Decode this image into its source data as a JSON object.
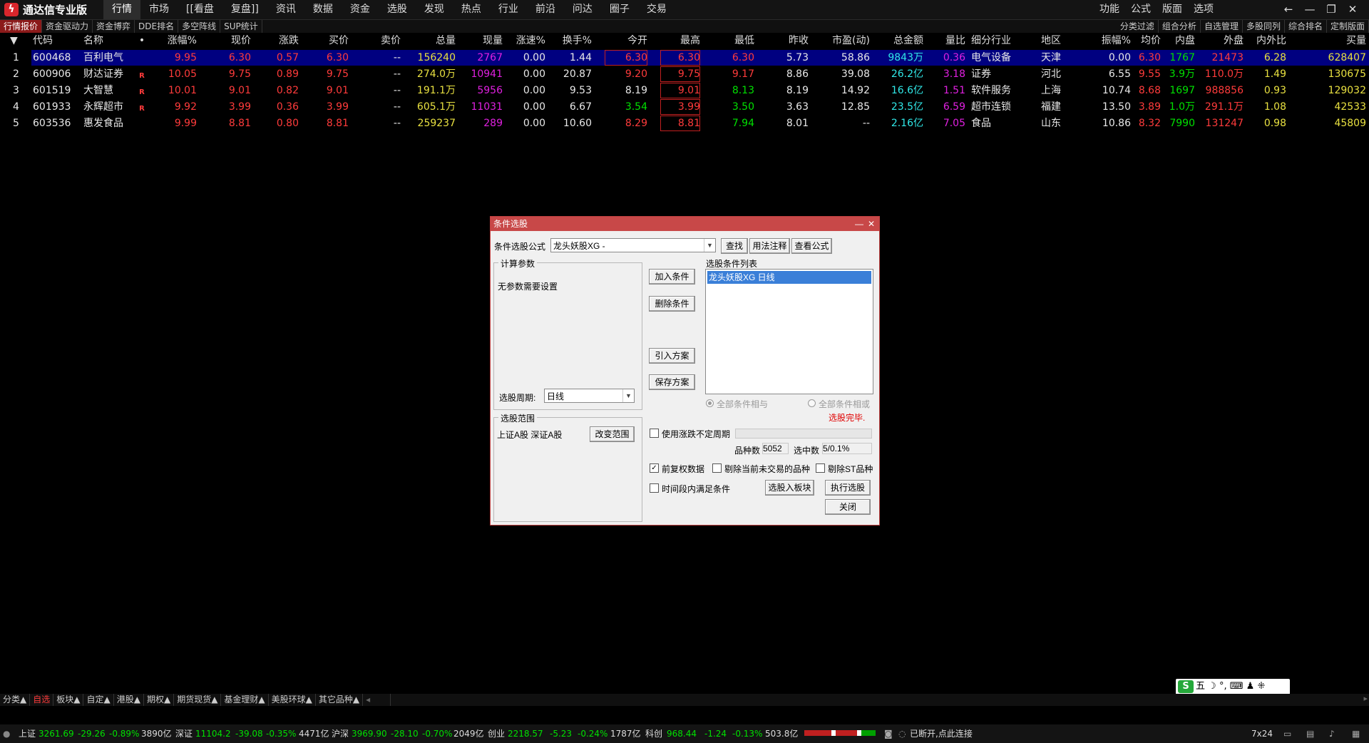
{
  "titlebar": {
    "app_name": "通达信专业版",
    "menu": [
      "行情",
      "市场",
      "[[看盘",
      "复盘]]",
      "资讯",
      "数据",
      "资金",
      "选股",
      "发现",
      "热点",
      "行业",
      "前沿",
      "问达",
      "圈子",
      "交易"
    ],
    "right_menu": [
      "功能",
      "公式",
      "版面",
      "选项"
    ]
  },
  "subtabs": [
    "行情报价",
    "资金驱动力",
    "资金博弈",
    "DDE排名",
    "多空阵线",
    "SUP统计"
  ],
  "subtabs_right": [
    "分类过滤",
    "组合分析",
    "自选管理",
    "多股同列",
    "综合排名",
    "定制版面"
  ],
  "table": {
    "headers": [
      "代码",
      "名称",
      "•",
      "涨幅%",
      "现价",
      "涨跌",
      "买价",
      "卖价",
      "总量",
      "现量",
      "涨速%",
      "换手%",
      "今开",
      "最高",
      "最低",
      "昨收",
      "市盈(动)",
      "总金额",
      "量比",
      "细分行业",
      "地区",
      "振幅%",
      "均价",
      "内盘",
      "外盘",
      "内外比",
      "买量"
    ],
    "rows": [
      [
        "1",
        "600468",
        "百利电气",
        "",
        "9.95",
        "6.30",
        "0.57",
        "6.30",
        "--",
        "156240",
        "2767",
        "0.00",
        "1.44",
        "6.30",
        "6.30",
        "6.30",
        "5.73",
        "58.86",
        "9843万",
        "0.36",
        "电气设备",
        "天津",
        "0.00",
        "6.30",
        "1767",
        "21473",
        "6.28",
        "628407"
      ],
      [
        "2",
        "600906",
        "财达证券",
        "R",
        "10.05",
        "9.75",
        "0.89",
        "9.75",
        "--",
        "274.0万",
        "10941",
        "0.00",
        "20.87",
        "9.20",
        "9.75",
        "9.17",
        "8.86",
        "39.08",
        "26.2亿",
        "3.18",
        "证券",
        "河北",
        "6.55",
        "9.55",
        "3.9万",
        "110.0万",
        "1.49",
        "130675"
      ],
      [
        "3",
        "601519",
        "大智慧",
        "R",
        "10.01",
        "9.01",
        "0.82",
        "9.01",
        "--",
        "191.1万",
        "5956",
        "0.00",
        "9.53",
        "8.19",
        "9.01",
        "8.13",
        "8.19",
        "14.92",
        "16.6亿",
        "1.51",
        "软件服务",
        "上海",
        "10.74",
        "8.68",
        "1697",
        "988856",
        "0.93",
        "129032"
      ],
      [
        "4",
        "601933",
        "永辉超市",
        "R",
        "9.92",
        "3.99",
        "0.36",
        "3.99",
        "--",
        "605.1万",
        "11031",
        "0.00",
        "6.67",
        "3.54",
        "3.99",
        "3.50",
        "3.63",
        "12.85",
        "23.5亿",
        "6.59",
        "超市连锁",
        "福建",
        "13.50",
        "3.89",
        "1.0万",
        "291.1万",
        "1.08",
        "42533"
      ],
      [
        "5",
        "603536",
        "惠发食品",
        "",
        "9.99",
        "8.81",
        "0.80",
        "8.81",
        "--",
        "259237",
        "289",
        "0.00",
        "10.60",
        "8.29",
        "8.81",
        "7.94",
        "8.01",
        "--",
        "2.16亿",
        "7.05",
        "食品",
        "山东",
        "10.86",
        "8.32",
        "7990",
        "131247",
        "0.98",
        "45809"
      ]
    ]
  },
  "dialog": {
    "title": "条件选股",
    "formula_label": "条件选股公式",
    "formula_value": "龙头妖股XG   -",
    "btn_find": "查找",
    "btn_usage": "用法注释",
    "btn_view": "查看公式",
    "calc_params_label": "计算参数",
    "no_params": "无参数需要设置",
    "period_label": "选股周期:",
    "period_value": "日线",
    "btn_add": "加入条件",
    "btn_delete": "删除条件",
    "btn_import": "引入方案",
    "btn_save": "保存方案",
    "cond_list_label": "选股条件列表",
    "cond_item": "龙头妖股XG  日线",
    "radio_and": "全部条件相与",
    "radio_or": "全部条件相或",
    "status": "选股完毕.",
    "range_label": "选股范围",
    "range_value": "上证A股 深证A股",
    "btn_change_range": "改变范围",
    "chk_use_period": "使用涨跌不定周期",
    "count_label": "品种数",
    "count_value": "5052",
    "selected_label": "选中数",
    "selected_value": "5/0.1%",
    "chk_prefq": "前复权数据",
    "chk_remove_notrade": "剔除当前未交易的品种",
    "chk_remove_st": "剔除ST品种",
    "chk_time_range": "时间段内满足条件",
    "btn_to_block": "选股入板块",
    "btn_execute": "执行选股",
    "btn_close": "关闭"
  },
  "bottom_tabs": [
    "分类▲",
    "自选",
    "板块▲",
    "自定▲",
    "港股▲",
    "期权▲",
    "期货现货▲",
    "基金理财▲",
    "美股环球▲",
    "其它品种▲"
  ],
  "ime": {
    "label": "五"
  },
  "statusbar": {
    "sh": {
      "name": "上证",
      "value": "3261.69",
      "chg": "-29.26",
      "pct": "-0.89%",
      "amt": "3890亿"
    },
    "sz": {
      "name": "深证",
      "value": "11104.2",
      "chg": "-39.08",
      "pct": "-0.35%",
      "amt": "4471亿"
    },
    "hs": {
      "name": "沪深",
      "value": "3969.90",
      "chg": "-28.10",
      "pct": "-0.70%",
      "amt": "2049亿"
    },
    "cy": {
      "name": "创业",
      "value": "2218.57",
      "chg": "-5.23",
      "pct": "-0.24%",
      "amt": "1787亿"
    },
    "kc": {
      "name": "科创",
      "value": "968.44",
      "chg": "-1.24",
      "pct": "-0.13%",
      "amt": "503.8亿"
    },
    "conn": "已断开,点此连接",
    "mode": "7x24"
  },
  "colors": {
    "up": "#ff3b3b",
    "down": "#00e000",
    "selected_row": "#000080",
    "dialog_title": "#c84848"
  }
}
